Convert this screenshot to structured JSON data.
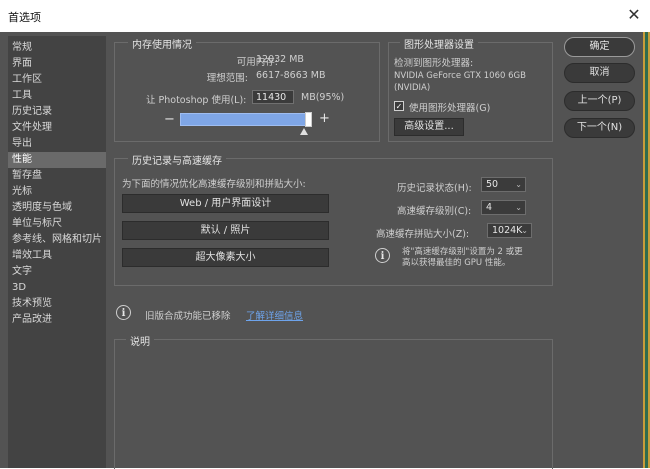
{
  "window": {
    "title": "首选项"
  },
  "sidebar": {
    "items": [
      "常规",
      "界面",
      "工作区",
      "工具",
      "历史记录",
      "文件处理",
      "导出",
      "性能",
      "暂存盘",
      "光标",
      "透明度与色域",
      "单位与标尺",
      "参考线、网格和切片",
      "增效工具",
      "文字",
      "3D",
      "技术预览",
      "产品改进"
    ],
    "selected_index": 7
  },
  "memory": {
    "group_title": "内存使用情况",
    "available_label": "可用内存:",
    "available_value": "12032 MB",
    "ideal_label": "理想范围:",
    "ideal_value": "6617-8663 MB",
    "use_label": "让 Photoshop 使用(L):",
    "use_value": "11430",
    "use_unit": "MB(95%)",
    "slider_level_percent": 95,
    "minus": "−",
    "plus": "+"
  },
  "gpu": {
    "group_title": "图形处理器设置",
    "detected_label": "检测到图形处理器:",
    "gpu_name_line1": "NVIDIA GeForce GTX 1060 6GB",
    "gpu_name_line2": "(NVIDIA)",
    "use_gpu_label": "使用图形处理器(G)",
    "use_gpu_checked": true,
    "advanced_button": "高级设置..."
  },
  "buttons": {
    "ok": "确定",
    "cancel": "取消",
    "prev": "上一个(P)",
    "next": "下一个(N)"
  },
  "history": {
    "group_title": "历史记录与高速缓存",
    "optimize_label": "为下面的情况优化高速缓存级别和拼贴大小:",
    "preset_web": "Web / 用户界面设计",
    "preset_default": "默认 / 照片",
    "preset_huge": "超大像素大小",
    "states_label": "历史记录状态(H):",
    "states_value": "50",
    "levels_label": "高速缓存级别(C):",
    "levels_value": "4",
    "tile_label": "高速缓存拼贴大小(Z):",
    "tile_value": "1024K",
    "tip_line1": "将\"高速缓存级别\"设置为 2 或更",
    "tip_line2": "高以获得最佳的 GPU 性能。"
  },
  "legacy": {
    "text": "旧版合成功能已移除",
    "link": "了解详细信息"
  },
  "description": {
    "group_title": "说明"
  }
}
